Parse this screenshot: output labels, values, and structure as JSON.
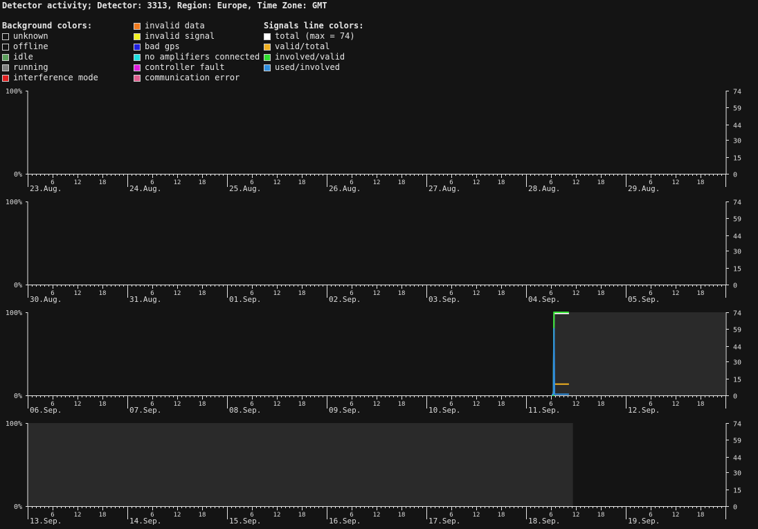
{
  "title": "Detector activity; Detector: 3313, Region: Europe, Time Zone: GMT",
  "legend": {
    "background_heading": "Background colors:",
    "signals_heading": "Signals line colors:",
    "background_col1": [
      {
        "label": "unknown",
        "color": "#141414",
        "icon": "square-outline-icon"
      },
      {
        "label": "offline",
        "color": "#141414",
        "icon": "square-outline-icon"
      },
      {
        "label": "idle",
        "color": "#5a9e5a",
        "icon": "square-icon"
      },
      {
        "label": "running",
        "color": "#7f7f7f",
        "icon": "square-icon"
      },
      {
        "label": "interference mode",
        "color": "#e02020",
        "icon": "square-icon"
      }
    ],
    "background_col2": [
      {
        "label": "invalid data",
        "color": "#f07a1e",
        "icon": "square-icon"
      },
      {
        "label": "invalid signal",
        "color": "#f0f020",
        "icon": "square-icon"
      },
      {
        "label": "bad gps",
        "color": "#2020e0",
        "icon": "square-icon"
      },
      {
        "label": "no amplifiers connected",
        "color": "#20e0e0",
        "icon": "square-icon"
      },
      {
        "label": "controller fault",
        "color": "#e020e0",
        "icon": "square-icon"
      },
      {
        "label": "communication error",
        "color": "#e06090",
        "icon": "square-icon"
      }
    ],
    "signals": [
      {
        "label": "total (max = 74)",
        "color": "#ffffff",
        "icon": "square-icon"
      },
      {
        "label": "valid/total",
        "color": "#f0b020",
        "icon": "square-icon"
      },
      {
        "label": "involved/valid",
        "color": "#30e030",
        "icon": "square-icon"
      },
      {
        "label": "used/involved",
        "color": "#3090e0",
        "icon": "square-icon"
      }
    ]
  },
  "colors": {
    "background": "#141414",
    "axis": "#e6e6e6",
    "no_data_band": "#2a2a2a"
  },
  "chart_data": [
    {
      "type": "area",
      "days": [
        "23.Aug.",
        "24.Aug.",
        "25.Aug.",
        "26.Aug.",
        "27.Aug.",
        "28.Aug.",
        "29.Aug."
      ],
      "hour_ticks": [
        "6",
        "12",
        "18"
      ],
      "left_axis": [
        "100%",
        "0%"
      ],
      "right_axis": [
        "74",
        "59",
        "44",
        "30",
        "15",
        "0"
      ],
      "shaded_ranges": [],
      "series": []
    },
    {
      "type": "area",
      "days": [
        "30.Aug.",
        "31.Aug.",
        "01.Sep.",
        "02.Sep.",
        "03.Sep.",
        "04.Sep.",
        "05.Sep."
      ],
      "hour_ticks": [
        "6",
        "12",
        "18"
      ],
      "left_axis": [
        "100%",
        "0%"
      ],
      "right_axis": [
        "74",
        "59",
        "44",
        "30",
        "15",
        "0"
      ],
      "shaded_ranges": [],
      "series": []
    },
    {
      "type": "area",
      "days": [
        "06.Sep.",
        "07.Sep.",
        "08.Sep.",
        "09.Sep.",
        "10.Sep.",
        "11.Sep.",
        "12.Sep."
      ],
      "hour_ticks": [
        "6",
        "12",
        "18"
      ],
      "left_axis": [
        "100%",
        "0%"
      ],
      "right_axis": [
        "74",
        "59",
        "44",
        "30",
        "15",
        "0"
      ],
      "shaded_ranges": [
        {
          "from_day": 5.28,
          "to_day": 7
        }
      ],
      "series": [
        {
          "name": "total (max = 74)",
          "color": "#ffffff",
          "points": [
            [
              5.26,
              0
            ],
            [
              5.275,
              0
            ],
            [
              5.28,
              73
            ],
            [
              5.43,
              73
            ]
          ]
        },
        {
          "name": "valid/total",
          "color": "#f0b020",
          "points": [
            [
              5.27,
              0
            ],
            [
              5.28,
              10
            ],
            [
              5.43,
              10
            ]
          ]
        },
        {
          "name": "involved/valid",
          "color": "#30e030",
          "points": [
            [
              5.26,
              0
            ],
            [
              5.275,
              0
            ],
            [
              5.28,
              74
            ],
            [
              5.43,
              74
            ]
          ]
        },
        {
          "name": "used/involved",
          "color": "#3090e0",
          "points": [
            [
              5.26,
              0
            ],
            [
              5.275,
              2
            ],
            [
              5.28,
              60
            ],
            [
              5.285,
              1
            ],
            [
              5.43,
              1
            ]
          ]
        }
      ]
    },
    {
      "type": "area",
      "days": [
        "13.Sep.",
        "14.Sep.",
        "15.Sep.",
        "16.Sep.",
        "17.Sep.",
        "18.Sep.",
        "19.Sep."
      ],
      "hour_ticks": [
        "6",
        "12",
        "18"
      ],
      "left_axis": [
        "100%",
        "0%"
      ],
      "right_axis": [
        "74",
        "59",
        "44",
        "30",
        "15",
        "0"
      ],
      "shaded_ranges": [
        {
          "from_day": 0,
          "to_day": 5.47
        }
      ],
      "series": []
    }
  ]
}
